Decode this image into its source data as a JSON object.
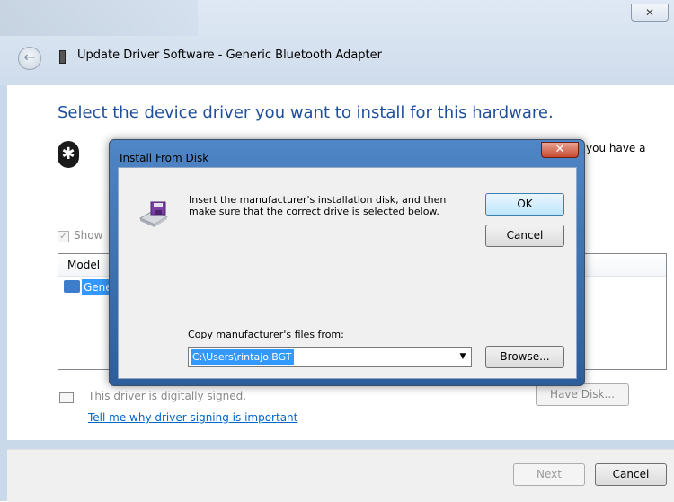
{
  "window": {
    "title": "Update Driver Software - Generic Bluetooth Adapter",
    "close_glyph": "✕"
  },
  "wizard": {
    "heading": "Select the device driver you want to install for this hardware.",
    "intro_tail": "you have a",
    "show_compatible_label": "Show",
    "model_column": "Model",
    "model_item": "Gene",
    "signing_text": "This driver is digitally signed.",
    "have_disk_label": "Have Disk...",
    "why_link": "Tell me why driver signing is important"
  },
  "footer": {
    "next_label": "Next",
    "cancel_label": "Cancel"
  },
  "dialog": {
    "title": "Install From Disk",
    "close_glyph": "✕",
    "message_line1": "Insert the manufacturer's installation disk, and then",
    "message_line2": "make sure that the correct drive is selected below.",
    "ok_label": "OK",
    "cancel_label": "Cancel",
    "copy_from_label": "Copy manufacturer's files from:",
    "copy_from_value": "C:\\Users\\rintajo.BGT",
    "browse_label": "Browse..."
  },
  "icons": {
    "back": "arrow-left-icon",
    "bluetooth": "bluetooth-icon",
    "floppy": "floppy-disk-icon",
    "certificate": "certificate-icon",
    "combo_arrow": "▼"
  },
  "colors": {
    "heading": "#1e4f9c",
    "link": "#0066cc",
    "selection": "#3399ff",
    "dialog_frame": "#2d5e9a",
    "close_red": "#c64a2e"
  }
}
